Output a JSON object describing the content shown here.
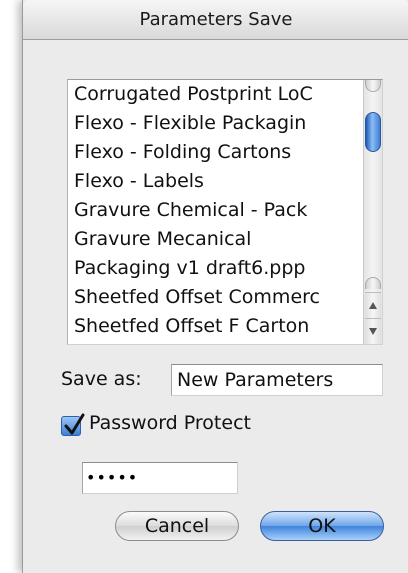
{
  "window": {
    "title": "Parameters Save"
  },
  "list": {
    "items": [
      "Corrugated Postprint LoC",
      "Flexo - Flexible Packagin",
      "Flexo - Folding Cartons",
      "Flexo - Labels",
      "Gravure Chemical - Pack",
      "Gravure Mecanical",
      "Packaging v1 draft6.ppp",
      "Sheetfed Offset Commerc",
      "Sheetfed Offset F Carton"
    ]
  },
  "save_as": {
    "label": "Save as:",
    "value": "New Parameters"
  },
  "password_protect": {
    "label": "Password Protect",
    "checked": true
  },
  "password": {
    "value": "•••••"
  },
  "buttons": {
    "cancel": "Cancel",
    "ok": "OK"
  },
  "colors": {
    "accent": "#3f84dc",
    "dialog_bg": "#ebebeb"
  }
}
